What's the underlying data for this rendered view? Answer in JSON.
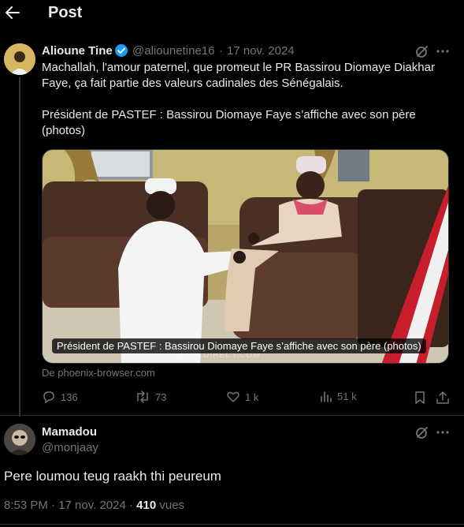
{
  "header": {
    "title": "Post"
  },
  "tweet": {
    "author_name": "Alioune Tine",
    "handle": "@aliounetine16",
    "date": "17 nov. 2024",
    "separator": "·",
    "text_line1": "Machallah, l'amour paternel, que promeut le PR Bassirou Diomaye Diakhar Faye,  ça fait partie des valeurs cadinales des Sénégalais.",
    "text_line2": "Président de PASTEF : Bassirou Diomaye Faye s’affiche avec son père (photos)",
    "media_caption": "Président de PASTEF : Bassirou Diomaye Faye s’affiche avec son père (photos)",
    "watermark": "SENEGALDIRECT.COM",
    "source": "De phoenix-browser.com",
    "replies": "136",
    "reposts": "73",
    "likes": "1 k",
    "views": "51 k"
  },
  "reply": {
    "author_name": "Mamadou",
    "handle": "@monjaay",
    "text": "Pere loumou teug raakh thi peureum",
    "timestamp": "8:53 PM · 17 nov. 2024 · ",
    "views_count": "410",
    "views_label": " vues"
  },
  "colors": {
    "background": "#000000",
    "text": "#e7e9ea",
    "muted": "#71767b",
    "verified": "#1d9bf0",
    "divider": "#2f3336"
  },
  "icons": [
    "back-arrow-icon",
    "verified-badge-icon",
    "grok-icon",
    "more-icon",
    "reply-icon",
    "repost-icon",
    "like-icon",
    "views-icon",
    "bookmark-icon",
    "share-icon"
  ]
}
